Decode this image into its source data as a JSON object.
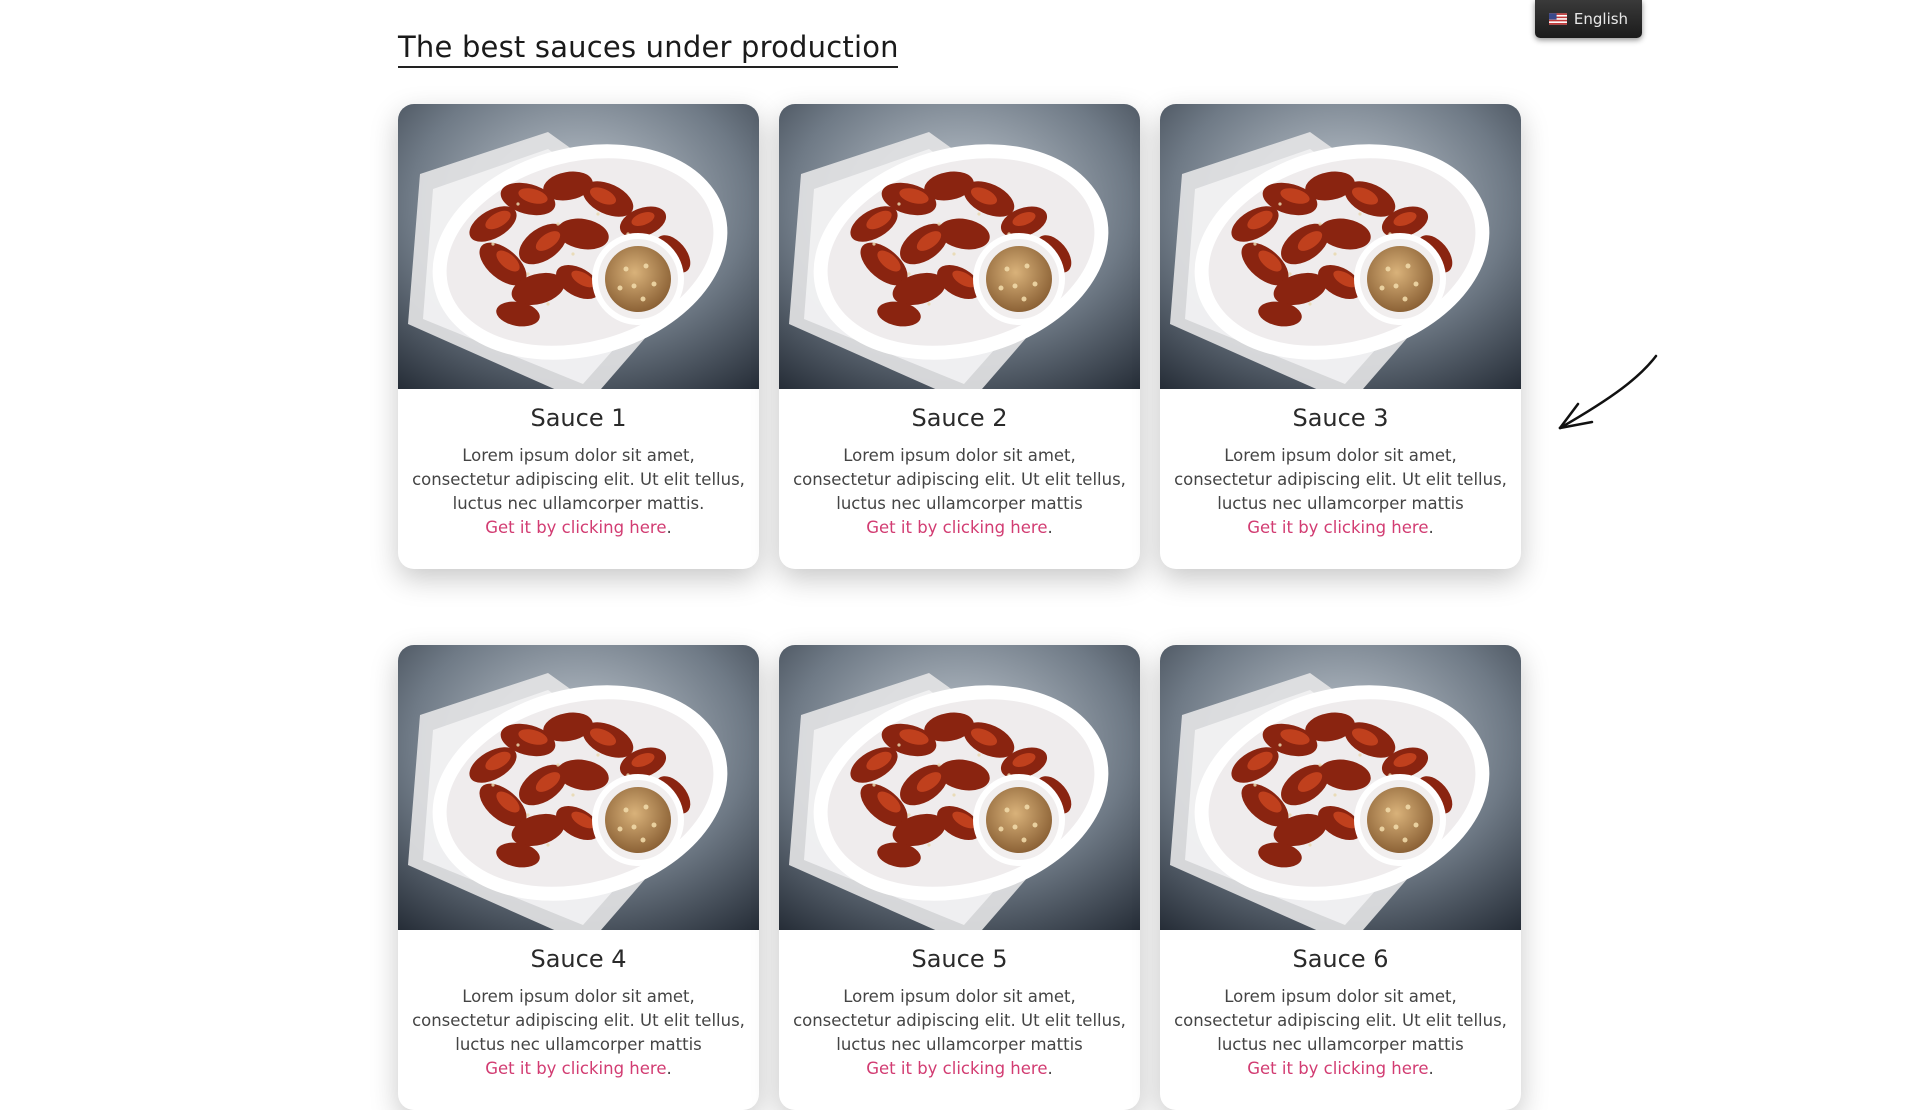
{
  "page": {
    "title": "The best sauces under production",
    "colors": {
      "link": "#d23c72",
      "title": "#1a1a1a",
      "lang_bg": "#262626"
    }
  },
  "language": {
    "label": "English",
    "flag_icon": "us-flag-icon"
  },
  "cards": [
    {
      "title": "Sauce 1",
      "description": "Lorem ipsum dolor sit amet, consectetur adipiscing elit. Ut elit tellus, luctus nec ullamcorper mattis.",
      "link_text": "Get it by clicking here",
      "link_suffix": "."
    },
    {
      "title": "Sauce 2",
      "description": "Lorem ipsum dolor sit amet, consectetur adipiscing elit. Ut elit tellus, luctus nec ullamcorper mattis",
      "link_text": "Get it by clicking here",
      "link_suffix": "."
    },
    {
      "title": "Sauce 3",
      "description": "Lorem ipsum dolor sit amet, consectetur adipiscing elit. Ut elit tellus, luctus nec ullamcorper mattis",
      "link_text": "Get it by clicking here",
      "link_suffix": "."
    },
    {
      "title": "Sauce 4",
      "description": "Lorem ipsum dolor sit amet, consectetur adipiscing elit. Ut elit tellus, luctus nec ullamcorper mattis",
      "link_text": "Get it by clicking here",
      "link_suffix": "."
    },
    {
      "title": "Sauce 5",
      "description": "Lorem ipsum dolor sit amet, consectetur adipiscing elit. Ut elit tellus, luctus nec ullamcorper mattis",
      "link_text": "Get it by clicking here",
      "link_suffix": "."
    },
    {
      "title": "Sauce 6",
      "description": "Lorem ipsum dolor sit amet, consectetur adipiscing elit. Ut elit tellus, luctus nec ullamcorper mattis",
      "link_text": "Get it by clicking here",
      "link_suffix": "."
    }
  ]
}
